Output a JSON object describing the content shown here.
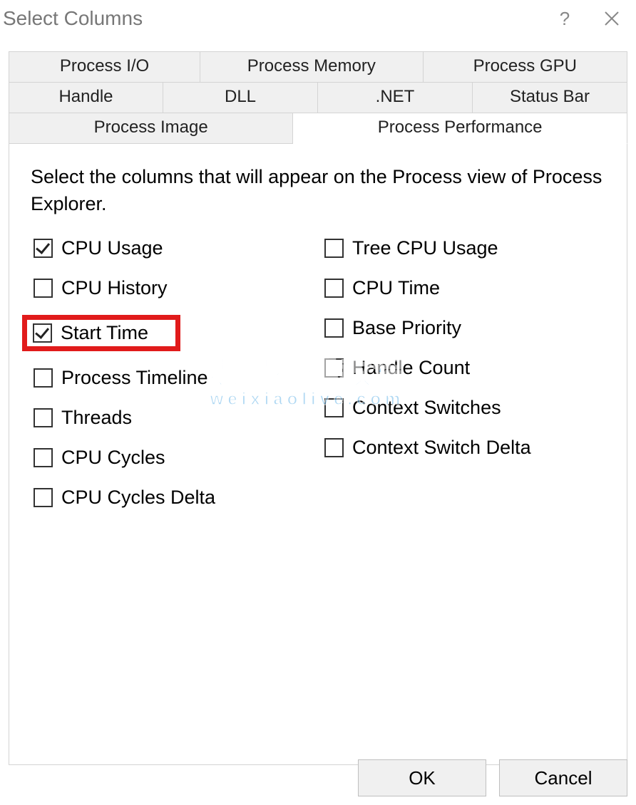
{
  "window": {
    "title": "Select Columns",
    "help_tooltip": "?",
    "close_tooltip": "Close"
  },
  "tabs": {
    "row0": [
      "Process I/O",
      "Process Memory",
      "Process GPU"
    ],
    "row1": [
      "Handle",
      "DLL",
      ".NET",
      "Status Bar"
    ],
    "row2": [
      "Process Image",
      "Process Performance"
    ],
    "active": "Process Performance"
  },
  "pane": {
    "instruction": "Select the columns that will appear on the Process view of Process Explorer.",
    "left": [
      {
        "label": "CPU Usage",
        "checked": true,
        "highlight": false
      },
      {
        "label": "CPU History",
        "checked": false,
        "highlight": false
      },
      {
        "label": "Start Time",
        "checked": true,
        "highlight": true
      },
      {
        "label": "Process Timeline",
        "checked": false,
        "highlight": false
      },
      {
        "label": "Threads",
        "checked": false,
        "highlight": false
      },
      {
        "label": "CPU Cycles",
        "checked": false,
        "highlight": false
      },
      {
        "label": "CPU Cycles Delta",
        "checked": false,
        "highlight": false
      }
    ],
    "right": [
      {
        "label": "Tree CPU Usage",
        "checked": false
      },
      {
        "label": "CPU Time",
        "checked": false
      },
      {
        "label": "Base Priority",
        "checked": false
      },
      {
        "label": "Handle Count",
        "checked": false
      },
      {
        "label": "Context Switches",
        "checked": false
      },
      {
        "label": "Context Switch Delta",
        "checked": false
      }
    ]
  },
  "buttons": {
    "ok": "OK",
    "cancel": "Cancel"
  },
  "watermark": {
    "line1": "老吴搭建教程",
    "line2": "weixiaolive.com"
  }
}
